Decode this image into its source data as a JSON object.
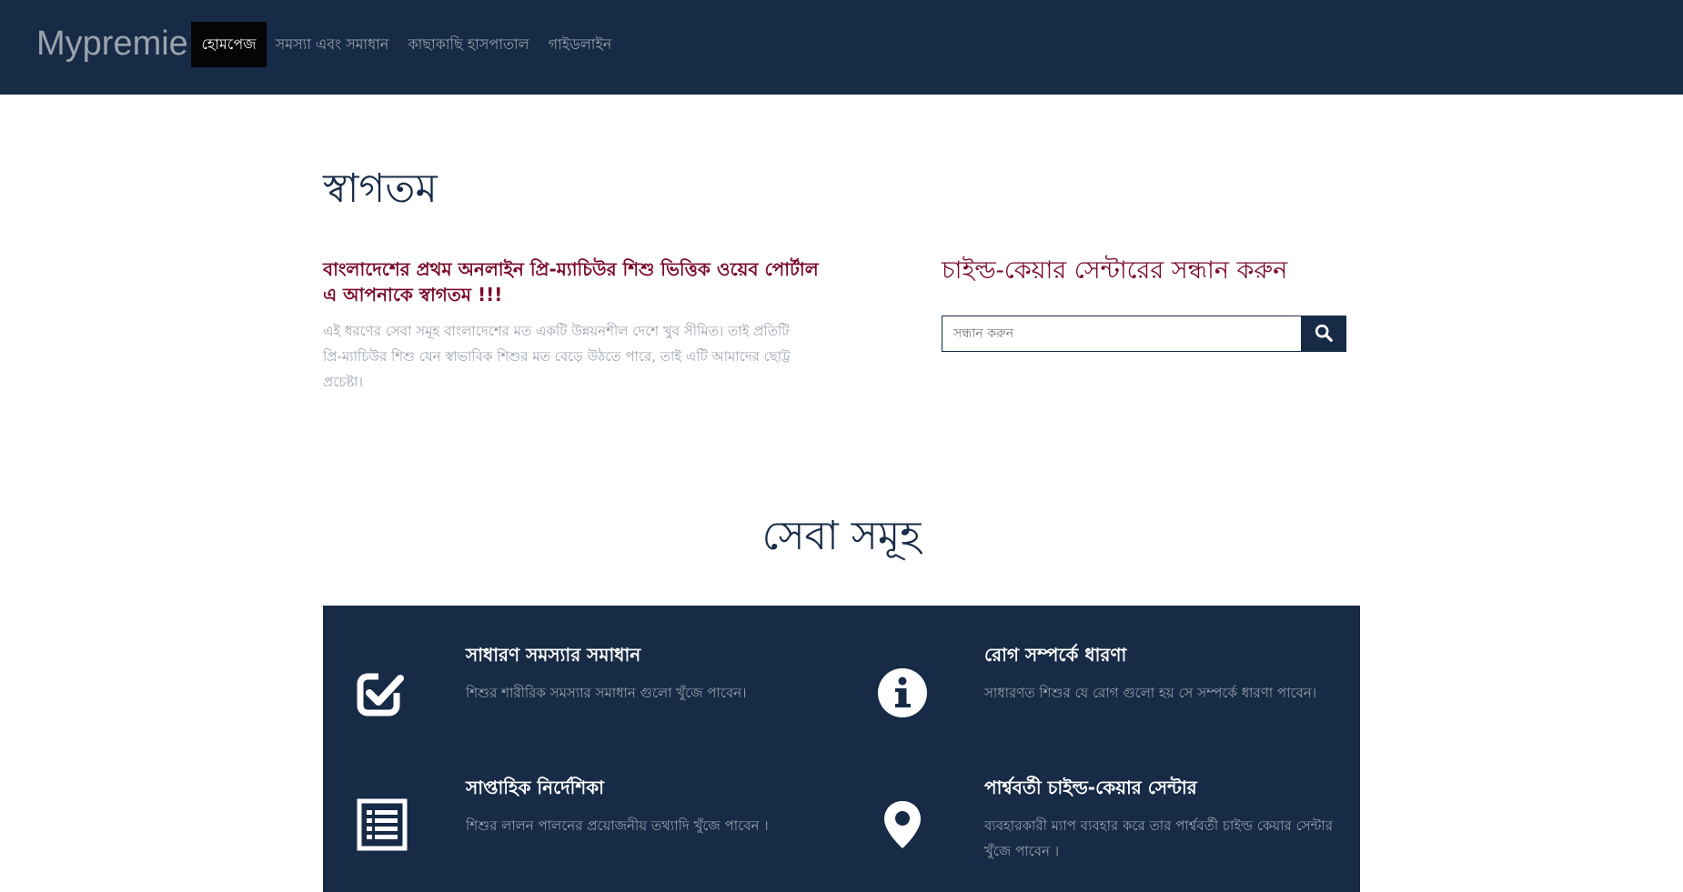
{
  "navbar": {
    "brand": "Mypremie",
    "items": [
      {
        "label": "হোমপেজ",
        "active": true
      },
      {
        "label": "সমস্যা এবং সমাধান",
        "active": false
      },
      {
        "label": "কাছাকাছি হাসপাতাল",
        "active": false
      },
      {
        "label": "গাইডলাইন",
        "active": false
      }
    ]
  },
  "welcome": {
    "title": "স্বাগতম",
    "heading": "বাংলাদেশের প্রথম অনলাইন প্রি-ম্যাচিউর শিশু ভিত্তিক ওয়েব পোর্টাল এ আপনাকে স্বাগতম !!!",
    "text": "এই ধরণের সেবা সমূহ বাংলাদেশের মত একটি উন্নয়নশীল দেশে খুব সীমিত। তাই প্রতিটি প্রি-ম্যাচিউর শিশু যেন স্বাভাবিক শিশুর মত বেড়ে উঠতে পারে, তাই এটি আমাদের ছোট্ট প্রচেষ্টা।"
  },
  "search": {
    "heading": "চাইল্ড-কেয়ার সেন্টারের সন্ধান করুন",
    "placeholder": "সন্ধান করুন",
    "button_icon": "search-icon"
  },
  "services": {
    "title": "সেবা সমূহ",
    "items": [
      {
        "icon": "check-square-icon",
        "title": "সাধারণ সমস্যার সমাধান",
        "description": "শিশুর শারীরিক সমস্যার সমাধান গুলো খুঁজে পাবেন।"
      },
      {
        "icon": "info-circle-icon",
        "title": "রোগ সম্পর্কে ধারণা",
        "description": "সাধারণত শিশুর যে রোগ গুলো হয় সে সম্পর্কে ধারণা পাবেন।"
      },
      {
        "icon": "list-alt-icon",
        "title": "সাপ্তাহিক নির্দেশিকা",
        "description": "শিশুর লালন পালনের প্রয়োজনীয় তথ্যাদি খুঁজে পাবেন ।"
      },
      {
        "icon": "map-marker-icon",
        "title": "পার্শ্ববর্তী চাইল্ড-কেয়ার সেন্টার",
        "description": "ব্যবহারকারী ম্যাপ ব্যবহার করে তার পার্শ্ববর্তী চাইল্ড কেয়ার সেন্টার খুঁজে পাবেন ।"
      }
    ]
  },
  "colors": {
    "navy": "#172a46",
    "maroon": "#7a0a2a",
    "muted_text": "#9aa3ad",
    "active_nav": "#050505"
  }
}
